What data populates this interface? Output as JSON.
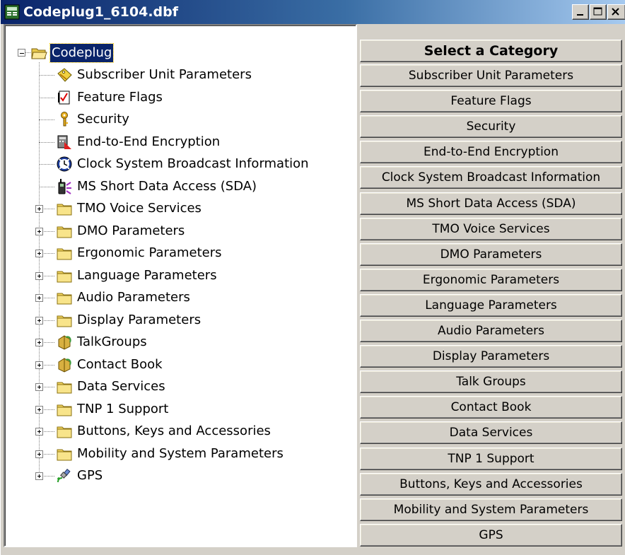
{
  "window": {
    "title": "Codeplug1_6104.dbf"
  },
  "tree": {
    "root": {
      "label": "Codeplug",
      "icon": "open-folder-icon"
    },
    "children": [
      {
        "label": "Subscriber Unit Parameters",
        "icon": "tag-icon",
        "expandable": false
      },
      {
        "label": "Feature Flags",
        "icon": "checklist-icon",
        "expandable": false
      },
      {
        "label": "Security",
        "icon": "key-icon",
        "expandable": false
      },
      {
        "label": "End-to-End Encryption",
        "icon": "encryption-icon",
        "expandable": false
      },
      {
        "label": "Clock System Broadcast Information",
        "icon": "clock-icon",
        "expandable": false
      },
      {
        "label": "MS Short Data Access (SDA)",
        "icon": "radio-icon",
        "expandable": false
      },
      {
        "label": "TMO Voice Services",
        "icon": "folder-icon",
        "expandable": true
      },
      {
        "label": "DMO Parameters",
        "icon": "folder-icon",
        "expandable": true
      },
      {
        "label": "Ergonomic Parameters",
        "icon": "folder-icon",
        "expandable": true
      },
      {
        "label": "Language Parameters",
        "icon": "folder-icon",
        "expandable": true
      },
      {
        "label": "Audio Parameters",
        "icon": "folder-icon",
        "expandable": true
      },
      {
        "label": "Display Parameters",
        "icon": "folder-icon",
        "expandable": true
      },
      {
        "label": "TalkGroups",
        "icon": "talkgroup-icon",
        "expandable": true
      },
      {
        "label": "Contact Book",
        "icon": "talkgroup-icon",
        "expandable": true
      },
      {
        "label": "Data Services",
        "icon": "folder-icon",
        "expandable": true
      },
      {
        "label": "TNP 1 Support",
        "icon": "folder-icon",
        "expandable": true
      },
      {
        "label": "Buttons, Keys and Accessories",
        "icon": "folder-icon",
        "expandable": true
      },
      {
        "label": "Mobility and System Parameters",
        "icon": "folder-icon",
        "expandable": true
      },
      {
        "label": "GPS",
        "icon": "satellite-icon",
        "expandable": true
      }
    ]
  },
  "category_panel": {
    "header": "Select a Category",
    "buttons": [
      "Subscriber Unit Parameters",
      "Feature Flags",
      "Security",
      "End-to-End Encryption",
      "Clock System Broadcast Information",
      "MS Short Data Access (SDA)",
      "TMO Voice Services",
      "DMO Parameters",
      "Ergonomic Parameters",
      "Language Parameters",
      "Audio Parameters",
      "Display Parameters",
      "Talk Groups",
      "Contact Book",
      "Data Services",
      "TNP 1 Support",
      "Buttons, Keys and Accessories",
      "Mobility and System Parameters",
      "GPS"
    ]
  }
}
